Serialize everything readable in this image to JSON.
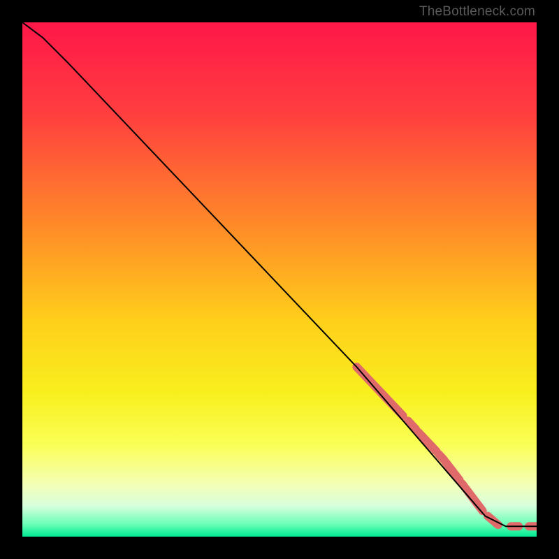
{
  "watermark": "TheBottleneck.com",
  "chart_data": {
    "type": "line",
    "title": "",
    "xlabel": "",
    "ylabel": "",
    "xlim": [
      0,
      100
    ],
    "ylim": [
      0,
      100
    ],
    "curve_points": [
      {
        "x": 0,
        "y": 100
      },
      {
        "x": 4,
        "y": 97
      },
      {
        "x": 9,
        "y": 92
      },
      {
        "x": 65,
        "y": 33
      },
      {
        "x": 90,
        "y": 4
      },
      {
        "x": 94,
        "y": 2
      },
      {
        "x": 100,
        "y": 2
      }
    ],
    "highlight_segments": [
      {
        "x1": 65,
        "y1": 33,
        "x2": 74,
        "y2": 23.5
      },
      {
        "x1": 75,
        "y1": 22.5,
        "x2": 76.5,
        "y2": 20.9
      },
      {
        "x1": 77,
        "y1": 20.3,
        "x2": 80.5,
        "y2": 16.6
      },
      {
        "x1": 81,
        "y1": 16,
        "x2": 82,
        "y2": 14.9
      },
      {
        "x1": 82.3,
        "y1": 14.5,
        "x2": 85,
        "y2": 11
      },
      {
        "x1": 85.5,
        "y1": 10.3,
        "x2": 89.5,
        "y2": 5
      },
      {
        "x1": 90.5,
        "y1": 4,
        "x2": 92.5,
        "y2": 2.3
      },
      {
        "x1": 95,
        "y1": 2,
        "x2": 96.5,
        "y2": 2
      },
      {
        "x1": 98.5,
        "y1": 2,
        "x2": 100,
        "y2": 2
      }
    ],
    "gradient_stops": [
      {
        "pos": 0.0,
        "color": "#ff1749"
      },
      {
        "pos": 0.18,
        "color": "#ff3f3f"
      },
      {
        "pos": 0.4,
        "color": "#ff8c28"
      },
      {
        "pos": 0.58,
        "color": "#ffcf1a"
      },
      {
        "pos": 0.72,
        "color": "#f8ef1e"
      },
      {
        "pos": 0.82,
        "color": "#fbff55"
      },
      {
        "pos": 0.9,
        "color": "#f3ffb8"
      },
      {
        "pos": 0.94,
        "color": "#d7ffdc"
      },
      {
        "pos": 0.975,
        "color": "#6dffb8"
      },
      {
        "pos": 1.0,
        "color": "#00e890"
      }
    ]
  }
}
